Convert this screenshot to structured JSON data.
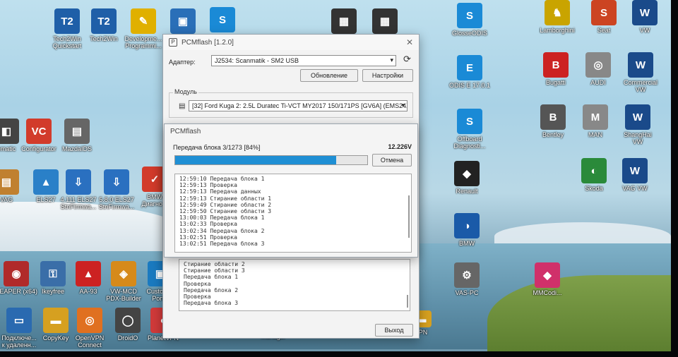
{
  "desktop_icons_left": [
    {
      "label": "Tech2Win\nQuickstart",
      "glyph": "T2",
      "color": "#1f5fa8"
    },
    {
      "label": "Tech2Win",
      "glyph": "T2",
      "color": "#1f5fa8"
    },
    {
      "label": "Developme...\nProgrammi...",
      "glyph": "✎",
      "color": "#e0b000"
    },
    {
      "label": "",
      "glyph": "▣",
      "color": "#2a6fb8"
    },
    {
      "label": "",
      "glyph": "S",
      "color": "#1a8ad6"
    },
    {
      "label": "",
      "glyph": "▦",
      "color": "#333"
    },
    {
      "label": "",
      "glyph": "▦",
      "color": "#333"
    },
    {
      "label": "ematic",
      "glyph": "◧",
      "color": "#444"
    },
    {
      "label": "Configurator",
      "glyph": "VC",
      "color": "#d23b2b"
    },
    {
      "label": "MazdaIDS",
      "glyph": "▤",
      "color": "#666"
    },
    {
      "label": "VAG",
      "glyph": "▤",
      "color": "#c08030"
    },
    {
      "label": "ELS27",
      "glyph": "▲",
      "color": "#2a80c8"
    },
    {
      "label": "4.111 ELS27\nStnFirmwa...",
      "glyph": "⇩",
      "color": "#2a70c0"
    },
    {
      "label": "5.8.0 ELS27\nStnFirmwa...",
      "glyph": "⇩",
      "color": "#2a70c0"
    },
    {
      "label": "BMW\nДиагно...",
      "glyph": "✓",
      "color": "#d23b2b"
    },
    {
      "label": "REAPER (x64)",
      "glyph": "◉",
      "color": "#b02a2a"
    },
    {
      "label": "Ikeyfree",
      "glyph": "⚿",
      "color": "#3a6ea8"
    },
    {
      "label": "AA-93",
      "glyph": "▲",
      "color": "#c22"
    },
    {
      "label": "VW-MCD\nPDX-Builder",
      "glyph": "◈",
      "color": "#d68a1a"
    },
    {
      "label": "Customer\nPortal",
      "glyph": "▣",
      "color": "#1a7ac0"
    },
    {
      "label": "Подключе...\nк удаленн...",
      "glyph": "▭",
      "color": "#2a6ab0"
    },
    {
      "label": "CopyKey",
      "glyph": "▬",
      "color": "#d6a020"
    },
    {
      "label": "OpenVPN\nConnect",
      "glyph": "◎",
      "color": "#e07020"
    },
    {
      "label": "DroidO",
      "glyph": "◯",
      "color": "#444"
    },
    {
      "label": "PlanetVPN",
      "glyph": "●",
      "color": "#d03a3a"
    }
  ],
  "desktop_icons_right": [
    {
      "label": "GlosseODIS",
      "glyph": "S",
      "color": "#1a8ad6"
    },
    {
      "label": "ODIS E 17.0.1",
      "glyph": "E",
      "color": "#1a8ad6"
    },
    {
      "label": "Offboard\nDiagnosti...",
      "glyph": "S",
      "color": "#1a8ad6"
    },
    {
      "label": "Renault",
      "glyph": "◆",
      "color": "#222"
    },
    {
      "label": "BMW",
      "glyph": "◑",
      "color": "#1a5aa8"
    },
    {
      "label": "VAS-PC",
      "glyph": "⚙",
      "color": "#666"
    },
    {
      "label": "Lamborghini",
      "glyph": "♞",
      "color": "#c9a400"
    },
    {
      "label": "Seat",
      "glyph": "S",
      "color": "#c42"
    },
    {
      "label": "VW",
      "glyph": "W",
      "color": "#1a4a8a"
    },
    {
      "label": "Bugatti",
      "glyph": "B",
      "color": "#c22"
    },
    {
      "label": "AUDI",
      "glyph": "◎",
      "color": "#888"
    },
    {
      "label": "Commercial\nVW",
      "glyph": "W",
      "color": "#1a4a8a"
    },
    {
      "label": "Bentley",
      "glyph": "B",
      "color": "#555"
    },
    {
      "label": "MAN",
      "glyph": "M",
      "color": "#888"
    },
    {
      "label": "ShangHai\nVW",
      "glyph": "W",
      "color": "#1a4a8a"
    },
    {
      "label": "Skoda",
      "glyph": "◐",
      "color": "#2a8a3a"
    },
    {
      "label": "VAG VW",
      "glyph": "W",
      "color": "#1a4a8a"
    },
    {
      "label": "MMCodi...",
      "glyph": "◆",
      "color": "#d0306a"
    }
  ],
  "taskbar_stubs": {
    "manager": "Manager",
    "vpn": "VPN"
  },
  "main_window": {
    "title": "PCMflash [1.2.0]",
    "adapter_label": "Адаптер:",
    "adapter_value": "J2534: Scanmatik - SM2 USB",
    "refresh_button": "Обновление",
    "settings_button": "Настройки",
    "module_group_label": "Модуль",
    "module_value": "[32] Ford Kuga 2: 2.5L Duratec Ti-VCT MY2017 150/171PS [GV6A] (EMS24XX)",
    "exit_button": "Выход",
    "lower_log": [
      "Стирание области 2",
      "Стирание области 3",
      "Передача блока 1",
      "Проверка",
      "Передача блока 2",
      "Проверка",
      "Передача блока 3"
    ]
  },
  "progress_dialog": {
    "title": "PCMflash",
    "status_text": "Передача блока 3/1273 [84%]",
    "voltage": "12.226V",
    "progress_percent": 84,
    "cancel_button": "Отмена",
    "log": [
      "12:59:10 Передача блока 1",
      "12:59:13 Проверка",
      "12:59:13 Передача данных",
      "12:59:13 Стирание области 1",
      "12:59:49 Стирание области 2",
      "12:59:50 Стирание области 3",
      "13:00:03 Передача блока 1",
      "13:02:33 Проверка",
      "13:02:34 Передача блока 2",
      "13:02:51 Проверка",
      "13:02:51 Передача блока 3"
    ]
  },
  "colors": {
    "accent": "#1f8fd4",
    "window_bg": "#f3f3f3"
  }
}
